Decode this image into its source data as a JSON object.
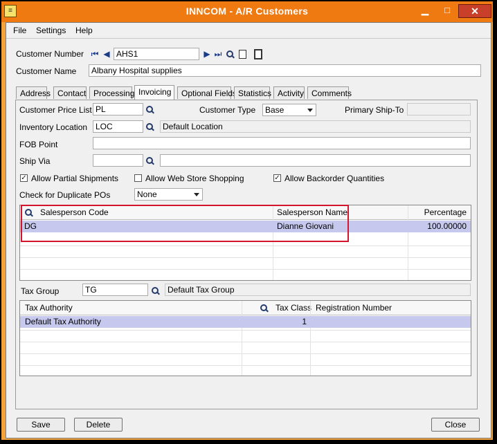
{
  "window": {
    "title": "INNCOM - A/R Customers",
    "icon": "app-icon"
  },
  "menu": {
    "file": "File",
    "settings": "Settings",
    "help": "Help"
  },
  "header": {
    "customer_number_label": "Customer Number",
    "customer_number": "AHS1",
    "customer_name_label": "Customer Name",
    "customer_name": "Albany Hospital supplies"
  },
  "tabs": [
    "Address",
    "Contact",
    "Processing",
    "Invoicing",
    "Optional Fields",
    "Statistics",
    "Activity",
    "Comments"
  ],
  "active_tab": "Invoicing",
  "invoicing": {
    "price_list_label": "Customer Price List",
    "price_list": "PL",
    "customer_type_label": "Customer Type",
    "customer_type": "Base",
    "primary_shipto_label": "Primary Ship-To",
    "primary_shipto": "",
    "inventory_location_label": "Inventory Location",
    "inventory_location": "LOC",
    "inventory_location_desc": "Default Location",
    "fob_label": "FOB Point",
    "fob": "",
    "ship_via_label": "Ship Via",
    "ship_via": "",
    "ship_via_desc": "",
    "allow_partial_label": "Allow Partial Shipments",
    "allow_partial": true,
    "allow_web_label": "Allow Web Store Shopping",
    "allow_web": false,
    "allow_backorder_label": "Allow Backorder Quantities",
    "allow_backorder": true,
    "dup_po_label": "Check for Duplicate POs",
    "dup_po": "None",
    "salesperson_grid": {
      "columns": [
        "Salesperson Code",
        "Salesperson Name",
        "Percentage"
      ],
      "rows": [
        {
          "code": "DG",
          "name": "Dianne  Giovani",
          "percentage": "100.00000"
        }
      ]
    },
    "tax_group_label": "Tax Group",
    "tax_group": "TG",
    "tax_group_desc": "Default Tax Group",
    "tax_grid": {
      "columns": [
        "Tax Authority",
        "Tax Class",
        "Registration Number"
      ],
      "rows": [
        {
          "authority": "Default Tax Authority",
          "class": "1",
          "registration": ""
        }
      ]
    }
  },
  "footer": {
    "save": "Save",
    "delete": "Delete",
    "close": "Close"
  },
  "colors": {
    "title_bar": "#f07a12",
    "frame": "#f4a23a",
    "selected_row": "#c6c8ee",
    "highlight_box": "#d3142c"
  }
}
